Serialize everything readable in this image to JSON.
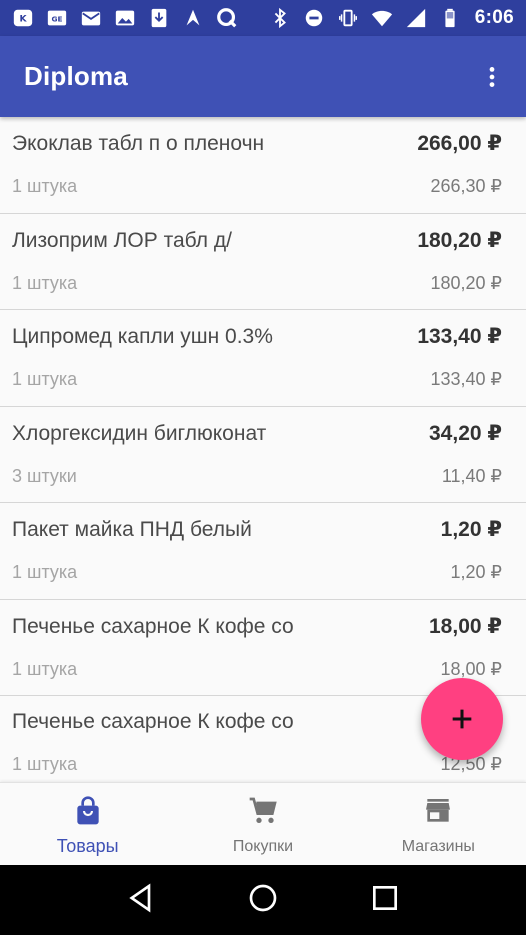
{
  "status_bar": {
    "time": "6:06"
  },
  "app_bar": {
    "title": "Diploma"
  },
  "items": [
    {
      "name": "Экоклав табл п о пленочн",
      "total": "266,00 ₽",
      "qty": "1 штука",
      "price": "266,30 ₽"
    },
    {
      "name": "Лизоприм ЛОР табл д/",
      "total": "180,20 ₽",
      "qty": "1 штука",
      "price": "180,20 ₽"
    },
    {
      "name": "Ципромед капли ушн 0.3%",
      "total": "133,40 ₽",
      "qty": "1 штука",
      "price": "133,40 ₽"
    },
    {
      "name": "Хлоргексидин биглюконат",
      "total": "34,20 ₽",
      "qty": "3 штуки",
      "price": "11,40 ₽"
    },
    {
      "name": "Пакет майка ПНД белый",
      "total": "1,20 ₽",
      "qty": "1 штука",
      "price": "1,20 ₽"
    },
    {
      "name": "Печенье сахарное К кофе со",
      "total": "18,00 ₽",
      "qty": "1 штука",
      "price": "18,00 ₽"
    },
    {
      "name": "Печенье сахарное К кофе со",
      "total": "",
      "qty": "1 штука",
      "price": "12,50 ₽"
    }
  ],
  "fab": {
    "icon": "plus-icon"
  },
  "bottom_nav": {
    "items": [
      {
        "label": "Товары",
        "icon": "shopping-bag-icon",
        "active": true
      },
      {
        "label": "Покупки",
        "icon": "shopping-cart-icon",
        "active": false
      },
      {
        "label": "Магазины",
        "icon": "store-icon",
        "active": false
      }
    ]
  },
  "colors": {
    "status_bar": "#2f3f9e",
    "primary": "#3f51b5",
    "accent": "#ff4081"
  }
}
